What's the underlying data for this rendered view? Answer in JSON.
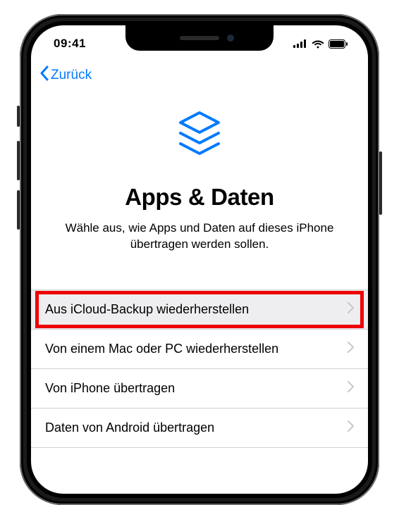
{
  "statusBar": {
    "time": "09:41"
  },
  "nav": {
    "backLabel": "Zurück"
  },
  "hero": {
    "title": "Apps & Daten",
    "subtitle": "Wähle aus, wie Apps und Daten auf dieses iPhone übertragen werden sollen."
  },
  "options": [
    {
      "label": "Aus iCloud-Backup wiederherstellen",
      "highlighted": true
    },
    {
      "label": "Von einem Mac oder PC wiederherstellen",
      "highlighted": false
    },
    {
      "label": "Von iPhone übertragen",
      "highlighted": false
    },
    {
      "label": "Daten von Android übertragen",
      "highlighted": false
    }
  ]
}
